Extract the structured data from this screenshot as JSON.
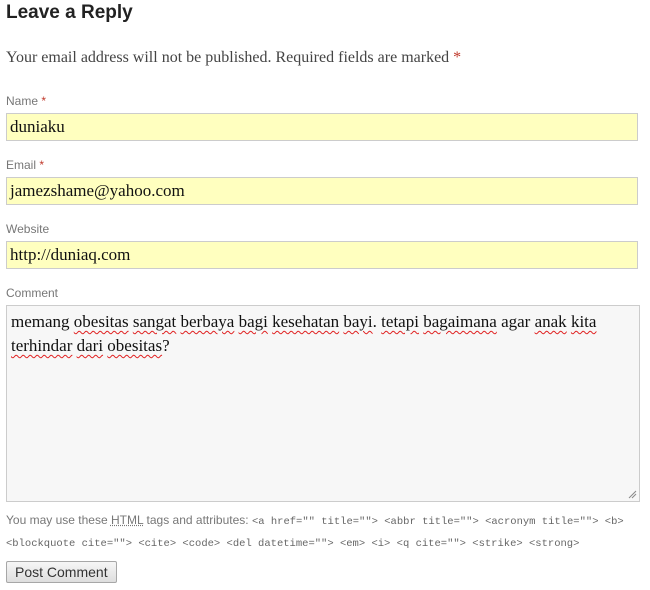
{
  "reply": {
    "title": "Leave a Reply",
    "notes": "Your email address will not be published. Required fields are marked",
    "required_marker": "*"
  },
  "fields": {
    "name": {
      "label": "Name",
      "value": "duniaku"
    },
    "email": {
      "label": "Email",
      "value": "jamezshame@yahoo.com"
    },
    "website": {
      "label": "Website",
      "value": "http://duniaq.com"
    },
    "comment": {
      "label": "Comment",
      "words": [
        "memang",
        " ",
        "obesitas",
        " ",
        "sangat",
        " ",
        "berbaya",
        " ",
        "bagi",
        " ",
        "kesehatan",
        " ",
        "bayi",
        ". ",
        "tetapi",
        " ",
        "bagaimana",
        " agar ",
        "anak",
        " ",
        "kita",
        " ",
        "terhindar",
        " ",
        "dari",
        " ",
        "obesitas",
        "?"
      ]
    }
  },
  "allowed_tags": {
    "intro_before": "You may use these ",
    "abbr": "HTML",
    "intro_after": " tags and attributes: ",
    "code": "<a href=\"\" title=\"\"> <abbr title=\"\"> <acronym title=\"\"> <b> <blockquote cite=\"\"> <cite> <code> <del datetime=\"\"> <em> <i> <q cite=\"\"> <strike> <strong>"
  },
  "submit": {
    "label": "Post Comment"
  },
  "colors": {
    "required": "#c0392b",
    "input_bg": "#ffffbf",
    "textarea_bg": "#f7f7f7",
    "spellcheck": "#e02020"
  },
  "icons": {
    "resize": "resize-grip-icon"
  }
}
